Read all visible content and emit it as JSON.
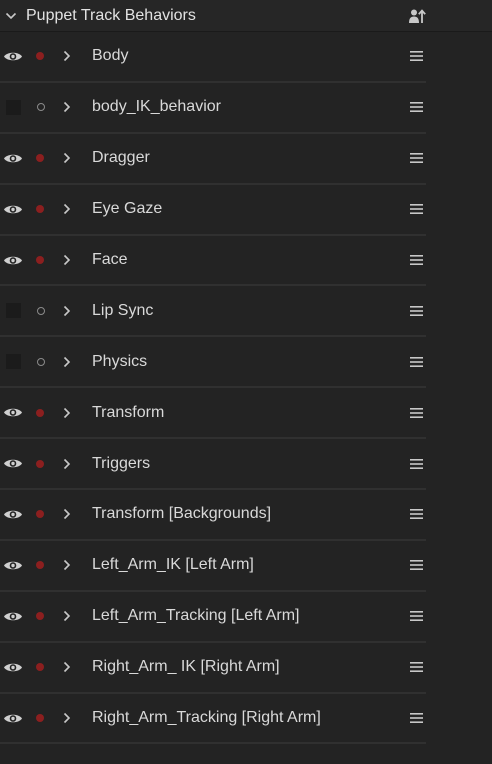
{
  "panel": {
    "title": "Puppet Track Behaviors",
    "collapse_icon": "chevron-down-icon",
    "add_icon": "add-behavior-icon"
  },
  "colors": {
    "background": "#232323",
    "row_divider": "#303030",
    "active_dot": "#8c1f1f",
    "text": "#d9d9d9"
  },
  "behaviors": [
    {
      "label": "Body",
      "enabled": true
    },
    {
      "label": "body_IK_behavior",
      "enabled": false
    },
    {
      "label": "Dragger",
      "enabled": true
    },
    {
      "label": "Eye Gaze",
      "enabled": true
    },
    {
      "label": "Face",
      "enabled": true
    },
    {
      "label": "Lip Sync",
      "enabled": false
    },
    {
      "label": "Physics",
      "enabled": false
    },
    {
      "label": "Transform",
      "enabled": true
    },
    {
      "label": "Triggers",
      "enabled": true
    },
    {
      "label": "Transform [Backgrounds]",
      "enabled": true
    },
    {
      "label": "Left_Arm_IK [Left Arm]",
      "enabled": true
    },
    {
      "label": "Left_Arm_Tracking [Left Arm]",
      "enabled": true
    },
    {
      "label": "Right_Arm_ IK [Right Arm]",
      "enabled": true
    },
    {
      "label": "Right_Arm_Tracking [Right Arm]",
      "enabled": true
    }
  ]
}
